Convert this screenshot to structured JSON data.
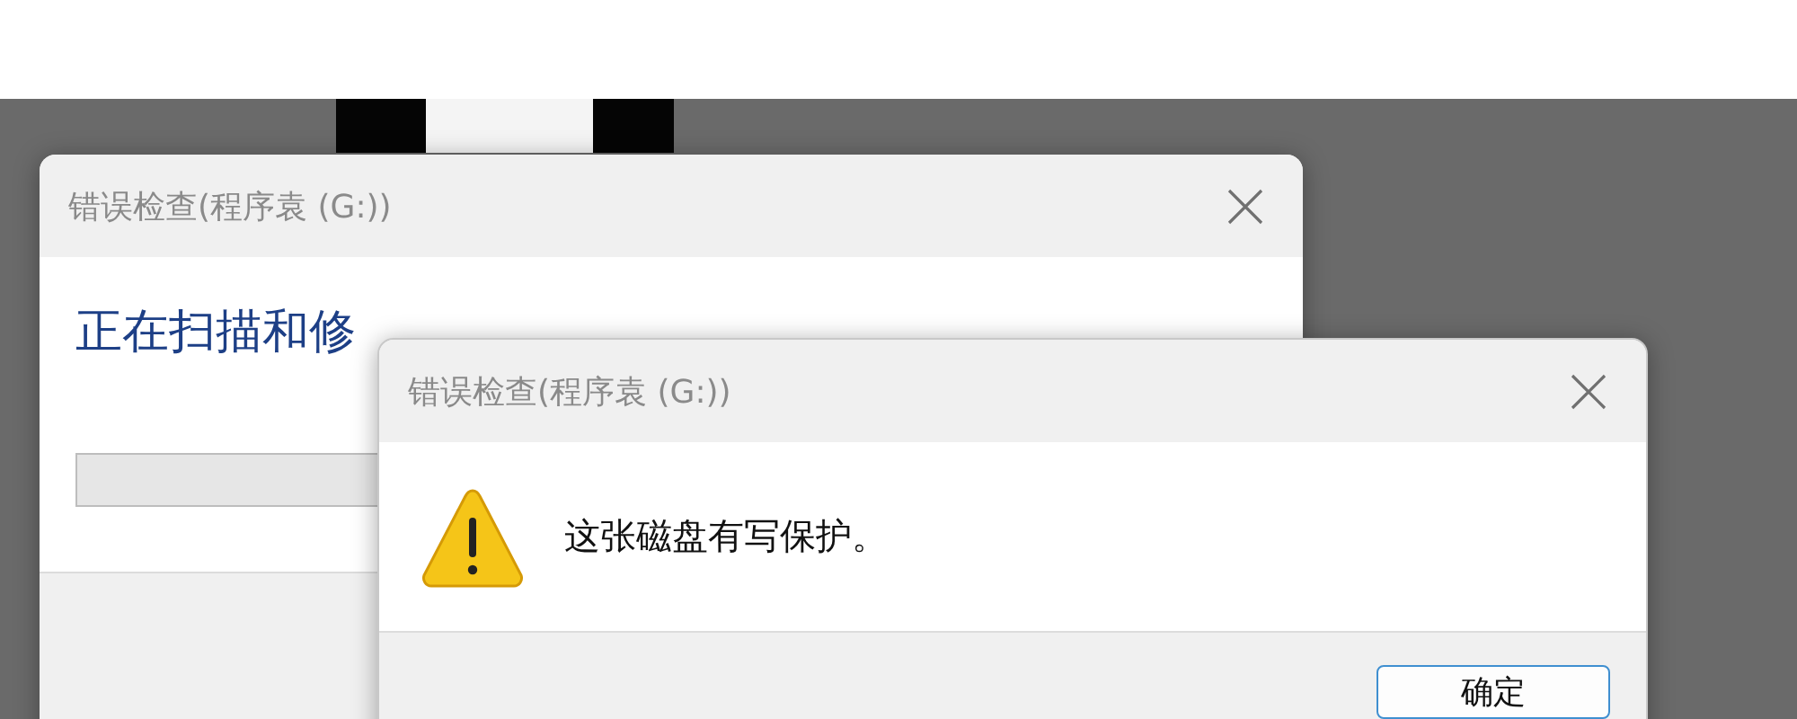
{
  "back_dialog": {
    "title": "错误检查(程序袁 (G:))",
    "heading": "正在扫描和修"
  },
  "front_dialog": {
    "title": "错误检查(程序袁 (G:))",
    "message": "这张磁盘有写保护。",
    "buttons": [
      "确定"
    ]
  }
}
